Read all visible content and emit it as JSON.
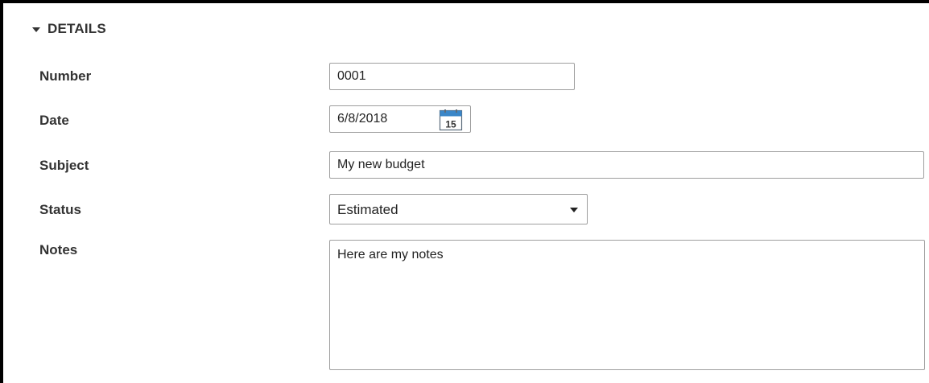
{
  "section": {
    "title": "DETAILS",
    "toggle_icon": "caret-down-icon"
  },
  "fields": {
    "number": {
      "label": "Number",
      "value": "0001"
    },
    "date": {
      "label": "Date",
      "value": "6/8/2018",
      "calendar_icon": "calendar-icon",
      "calendar_day": "15"
    },
    "subject": {
      "label": "Subject",
      "value": "My new budget"
    },
    "status": {
      "label": "Status",
      "value": "Estimated",
      "dropdown_icon": "caret-down-icon"
    },
    "notes": {
      "label": "Notes",
      "value": "Here are my notes"
    }
  },
  "colors": {
    "text": "#333333",
    "field_border": "#9e9e9e",
    "calendar_accent": "#3a86c8",
    "frame_border": "#000000"
  }
}
